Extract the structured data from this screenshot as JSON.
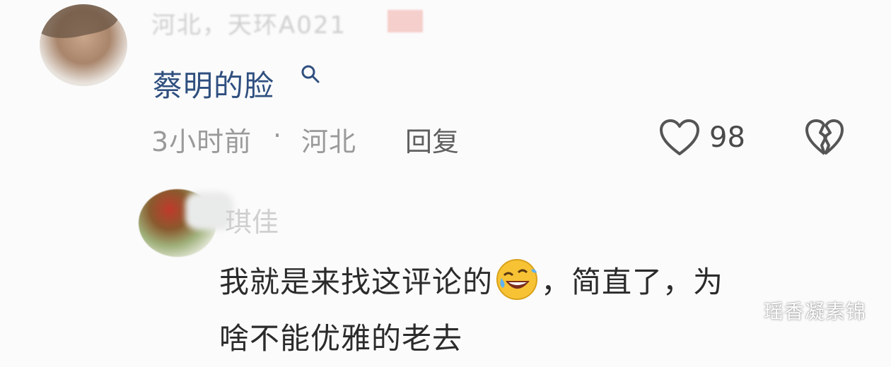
{
  "comment1": {
    "username": "河北，天环A021",
    "text": "蔡明的脸",
    "time": "3小时前",
    "location": "河北",
    "separator": "·",
    "reply_label": "回复",
    "like_count": "98"
  },
  "comment2": {
    "username": "琪佳",
    "text_part1": "我就是来找这评论的",
    "text_part2": "，简直了，为",
    "text_line2": "啥不能优雅的老去"
  },
  "watermark": "瑶香凝素锦",
  "icons": {
    "search": "search-icon",
    "like": "heart-outline-icon",
    "dislike": "broken-heart-icon",
    "emoji": "rolling-on-floor-laughing-emoji"
  },
  "colors": {
    "link": "#2f4f7f",
    "meta": "#9a9a9a",
    "text": "#2b2b2b"
  }
}
